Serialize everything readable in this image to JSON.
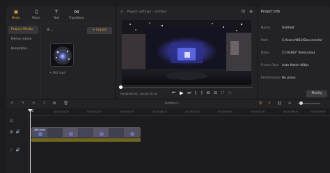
{
  "media_tabs": [
    {
      "label": "Media",
      "icon": "folder-icon",
      "active": true
    },
    {
      "label": "Music",
      "icon": "music-note-icon",
      "active": false
    },
    {
      "label": "Text",
      "icon": "text-icon",
      "active": false
    },
    {
      "label": "Transitions",
      "icon": "transitions-icon",
      "active": false
    }
  ],
  "side_nav": {
    "items": [
      "Project Media",
      "Demo media",
      "templates..."
    ]
  },
  "media_toolbar": {
    "import_label": "+ Import"
  },
  "media_item": {
    "name": "• 360.mp4"
  },
  "player": {
    "title": "Project settings - Untitled",
    "timecode": "00:00:00:00 / 00:00:25:10",
    "progress": 0.0
  },
  "info": {
    "title": "Project Info",
    "rows": [
      {
        "key": "Name",
        "value": "Untitled"
      },
      {
        "key": "Path",
        "value": "C:/Users/W10/Documents/"
      },
      {
        "key": "Ratio",
        "value": "21:9(360° Panorama)"
      },
      {
        "key": "Frame Rate",
        "value": "Auto Match 60fps"
      },
      {
        "key": "Performance",
        "value": "No proxy"
      }
    ],
    "modify_label": "Modify"
  },
  "timeline": {
    "name": "Untitled ⌄",
    "playhead_label": "0",
    "ruler": [
      "00:00:01:00",
      "00:00:02:00",
      "00:00:03:00",
      "00:00:04:00",
      "00:00:05:00",
      "00:00:06:00",
      "00:00:07:00",
      "00:00:08:00",
      "00:00:09:00"
    ],
    "clip_label": "360.mp4"
  },
  "colors": {
    "accent": "#e7a52e",
    "panel": "#232327",
    "background": "#1c1c1f"
  }
}
